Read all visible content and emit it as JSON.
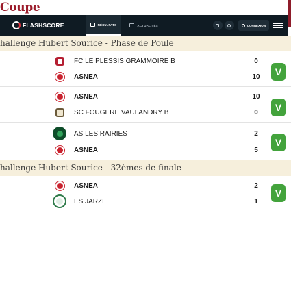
{
  "page": {
    "heading": "Coupe"
  },
  "navbar": {
    "logo_text": "FLASHSCORE",
    "tabs": [
      {
        "label": "RÉSULTATS",
        "active": true
      },
      {
        "label": "ACTUALITÉS",
        "active": false
      }
    ],
    "login_label": "CONNEXION"
  },
  "sections": [
    {
      "title": "hallenge Hubert Sourice - Phase de Poule",
      "matches": [
        {
          "home": {
            "name": "FC LE PLESSIS GRAMMOIRE B",
            "score": "0",
            "bold": false
          },
          "away": {
            "name": "ASNEA",
            "score": "10",
            "bold": true
          },
          "result": "V"
        },
        {
          "home": {
            "name": "ASNEA",
            "score": "10",
            "bold": true
          },
          "away": {
            "name": "SC FOUGERE VAULANDRY B",
            "score": "0",
            "bold": false
          },
          "result": "V"
        },
        {
          "home": {
            "name": "AS LES RAIRIES",
            "score": "2",
            "bold": false
          },
          "away": {
            "name": "ASNEA",
            "score": "5",
            "bold": true
          },
          "result": "V"
        }
      ]
    },
    {
      "title": "hallenge Hubert Sourice - 32èmes de finale",
      "matches": [
        {
          "home": {
            "name": "ASNEA",
            "score": "2",
            "bold": true
          },
          "away": {
            "name": "ES JARZE",
            "score": "1",
            "bold": false
          },
          "result": "V"
        }
      ]
    }
  ],
  "colors": {
    "win_badge": "#43a33c",
    "navbar_bg": "#0f1b23",
    "section_header_bg": "#f6efdc",
    "heading_color": "#9b1b2a"
  }
}
